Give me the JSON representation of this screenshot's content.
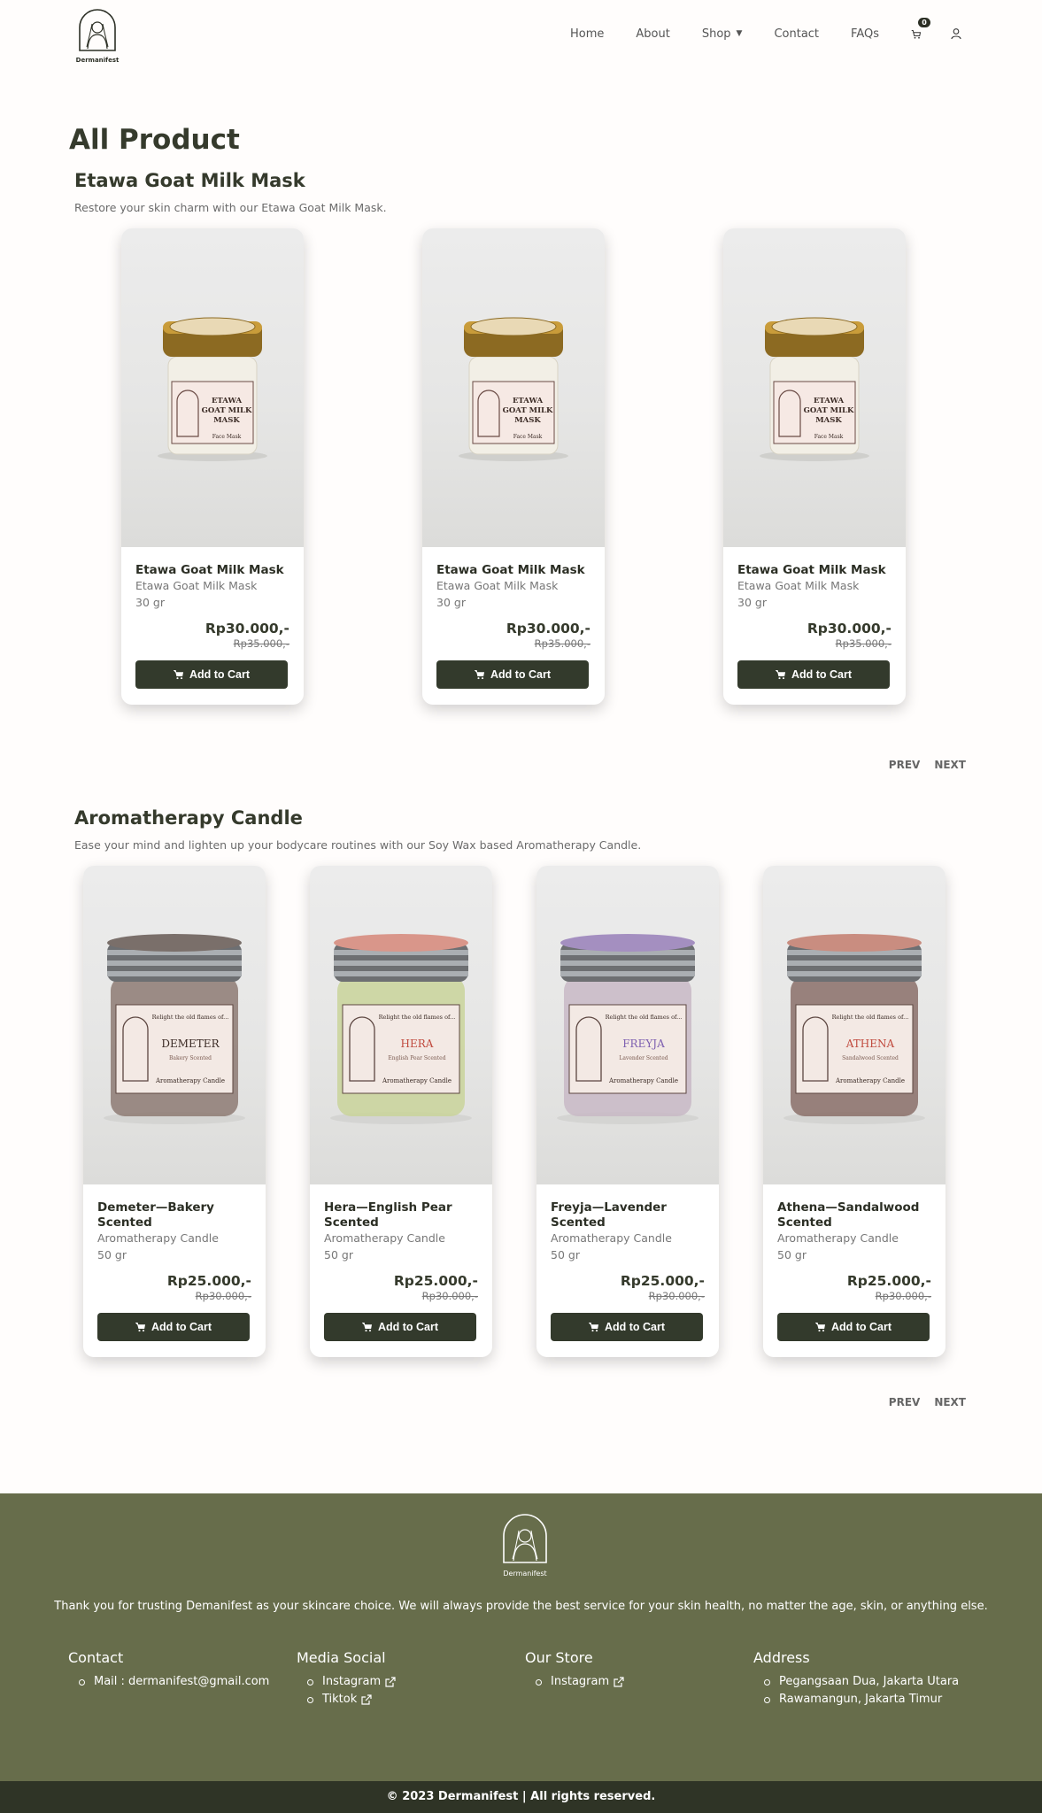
{
  "header": {
    "logo_text": "Dermanifest",
    "nav": [
      "Home",
      "About",
      "Shop",
      "Contact",
      "FAQs"
    ],
    "cart_count": "0"
  },
  "page_title": "All Product",
  "sections": [
    {
      "title": "Etawa Goat Milk Mask",
      "description": "Restore your skin charm with our Etawa Goat Milk Mask.",
      "products": [
        {
          "name": "Etawa Goat Milk Mask",
          "category": "Etawa Goat Milk Mask",
          "weight": "30 gr",
          "price": "Rp30.000,-",
          "old_price": "Rp35.000,-",
          "label": "ETAWA GOAT MILK MASK",
          "sublabel": "Face Mask"
        },
        {
          "name": "Etawa Goat Milk Mask",
          "category": "Etawa Goat Milk Mask",
          "weight": "30 gr",
          "price": "Rp30.000,-",
          "old_price": "Rp35.000,-",
          "label": "ETAWA GOAT MILK MASK",
          "sublabel": "Face Mask"
        },
        {
          "name": "Etawa Goat Milk Mask",
          "category": "Etawa Goat Milk Mask",
          "weight": "30 gr",
          "price": "Rp30.000,-",
          "old_price": "Rp35.000,-",
          "label": "ETAWA GOAT MILK MASK",
          "sublabel": "Face Mask"
        }
      ]
    },
    {
      "title": "Aromatherapy Candle",
      "description": "Ease your mind and lighten up your bodycare routines with our Soy Wax based Aromatherapy Candle.",
      "products": [
        {
          "name": "Demeter—Bakery Scented",
          "category": "Aromatherapy Candle",
          "weight": "50 gr",
          "price": "Rp25.000,-",
          "old_price": "Rp30.000,-",
          "label": "DEMETER",
          "sublabel": "Bakery Scented",
          "wax": "#8d7a73",
          "lid": "#7a6f6a"
        },
        {
          "name": "Hera—English Pear Scented",
          "category": "Aromatherapy Candle",
          "weight": "50 gr",
          "price": "Rp25.000,-",
          "old_price": "Rp30.000,-",
          "label": "HERA",
          "sublabel": "English Pear Scented",
          "wax": "#c9d39a",
          "lid": "#d9968a"
        },
        {
          "name": "Freyja—Lavender Scented",
          "category": "Aromatherapy Candle",
          "weight": "50 gr",
          "price": "Rp25.000,-",
          "old_price": "Rp30.000,-",
          "label": "FREYJA",
          "sublabel": "Lavender Scented",
          "wax": "#c8b9c6",
          "lid": "#a48fc0"
        },
        {
          "name": "Athena—Sandalwood Scented",
          "category": "Aromatherapy Candle",
          "weight": "50 gr",
          "price": "Rp25.000,-",
          "old_price": "Rp30.000,-",
          "label": "ATHENA",
          "sublabel": "Sandalwood Scented",
          "wax": "#8a6e68",
          "lid": "#c98d80"
        }
      ]
    }
  ],
  "buttons": {
    "add_to_cart": "Add to Cart",
    "prev": "PREV",
    "next": "NEXT"
  },
  "candle_label_tagline": "Relight the old flames of...",
  "candle_label_footer": "Aromatherapy Candle",
  "footer": {
    "logo_text": "Dermanifest",
    "thanks": "Thank you for trusting Demanifest as your skincare choice. We will always provide the best service for your skin health, no matter the age, skin, or anything else.",
    "contact": {
      "title": "Contact",
      "items": [
        "Mail : dermanifest@gmail.com"
      ]
    },
    "media": {
      "title": "Media Social",
      "items": [
        "Instagram",
        "Tiktok"
      ]
    },
    "store": {
      "title": "Our Store",
      "items": [
        "Instagram"
      ]
    },
    "address": {
      "title": "Address",
      "items": [
        "Pegangsaan Dua, Jakarta Utara",
        "Rawamangun, Jakarta Timur"
      ]
    },
    "copyright": "© 2023 Dermanifest | All rights reserved."
  },
  "colors": {
    "primary_dark": "#333a2c",
    "footer_bg": "#676d4b",
    "copyright_bg": "#2f3426"
  }
}
